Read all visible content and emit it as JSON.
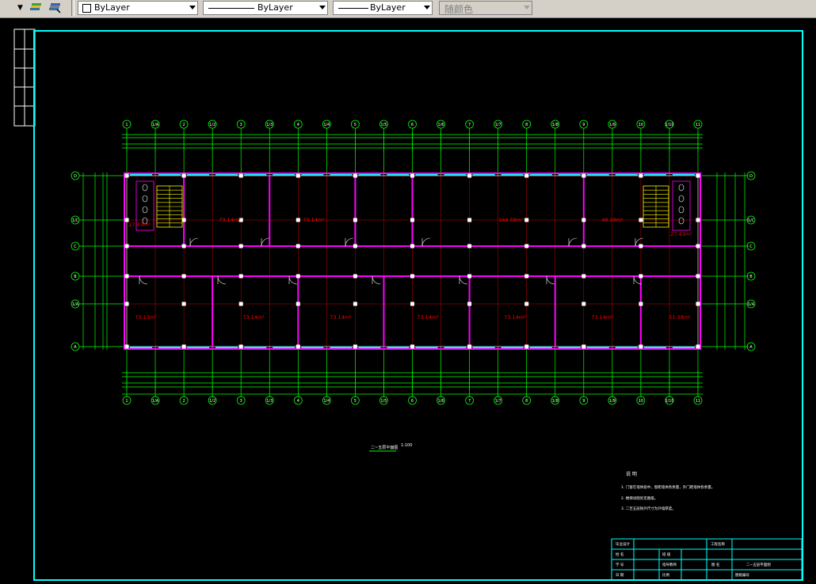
{
  "toolbar": {
    "dropdown_arrow": "▼",
    "layer_tools": [
      "layer-previous-icon",
      "layer-states-icon"
    ],
    "color_combo": "ByLayer",
    "linetype_combo": "ByLayer",
    "lineweight_combo": "ByLayer",
    "plotstyle_combo": "随颜色"
  },
  "drawing": {
    "grid_axes_top": [
      "1",
      "1/A",
      "2",
      "1/2",
      "3",
      "1/3",
      "4",
      "1/4",
      "5",
      "1/5",
      "6",
      "1/6",
      "7",
      "1/7",
      "8",
      "1/8",
      "9",
      "1/9",
      "10",
      "1/10",
      "11"
    ],
    "grid_axes_side": [
      "D",
      "1/C",
      "C",
      "B",
      "1/A",
      "A"
    ],
    "room_areas": [
      "27.43m²",
      "73.14m²",
      "73.14m²",
      "144.58m²",
      "48.28m²",
      "27.43m²",
      "73.13m²",
      "73.14m²",
      "73.14m²",
      "73.14m²",
      "73.14m²",
      "73.14m²",
      "51.38m²"
    ],
    "plan_title": "二~五层平面图",
    "plan_scale": "1:100",
    "notes_title": "说    明",
    "notes": [
      "1. 门窗在墙体居中，窗距墙体各余量，外门距墙体各余量。",
      "2. 楼梯详图另见图纸。",
      "3. 二至五层除外尺寸为外墙厚度。"
    ],
    "title_block": {
      "r1": [
        "毕业设计",
        "",
        "",
        "工程名称",
        ""
      ],
      "r2": [
        "姓  名",
        "",
        "班  级",
        "",
        ""
      ],
      "r3": [
        "学  号",
        "",
        "指导教师",
        "",
        "图  名",
        "二~五层平面图"
      ],
      "r4": [
        "日  期",
        "",
        "比例",
        "",
        "图纸编号",
        ""
      ]
    }
  },
  "colors": {
    "frame": "#00ffff",
    "wall": "#ff00ff",
    "dimension": "#00ff00",
    "room_text": "#ff0000",
    "stair": "#ffff00"
  }
}
